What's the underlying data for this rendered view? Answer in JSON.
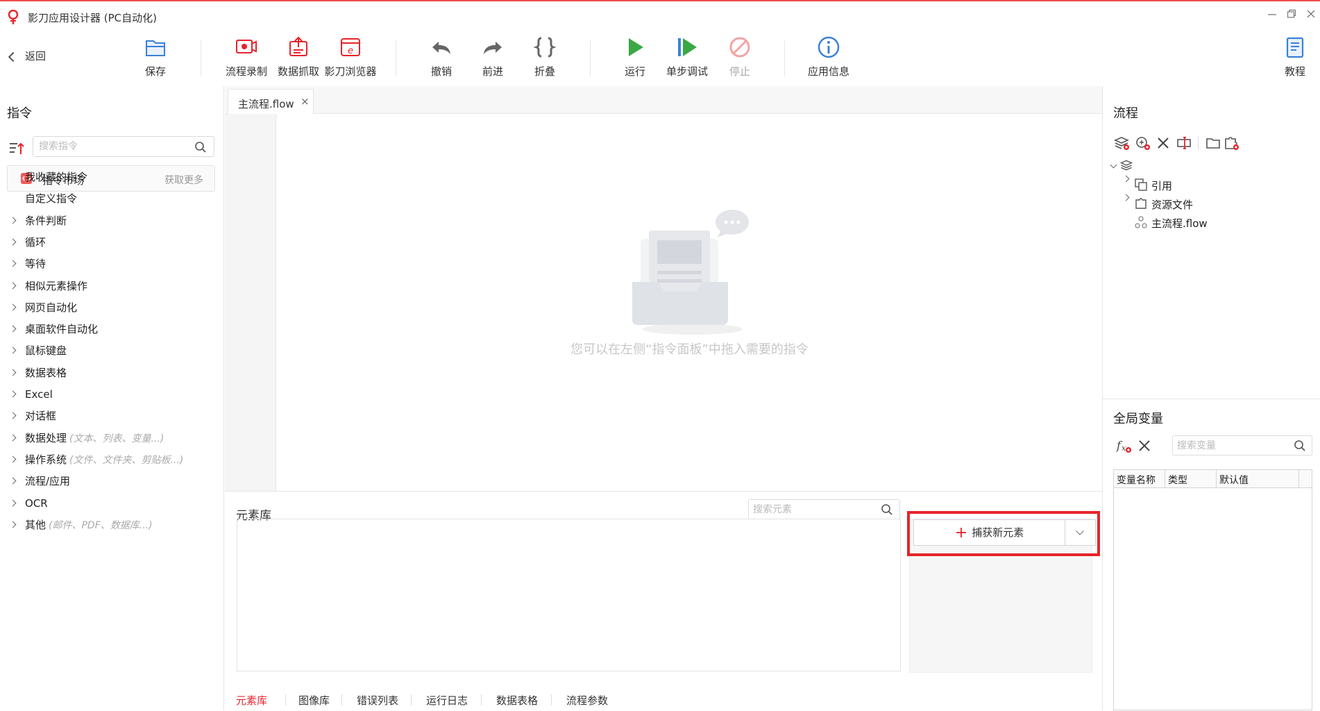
{
  "window": {
    "title": "影刀应用设计器 (PC自动化)"
  },
  "toolbar": {
    "back_label": "返回",
    "items": [
      {
        "label": "保存",
        "icon": "folder-save-icon"
      },
      {
        "label": "流程录制",
        "icon": "record-icon"
      },
      {
        "label": "数据抓取",
        "icon": "data-grab-icon"
      },
      {
        "label": "影刀浏览器",
        "icon": "browser-icon"
      },
      {
        "label": "撤销",
        "icon": "undo-icon"
      },
      {
        "label": "前进",
        "icon": "redo-icon"
      },
      {
        "label": "折叠",
        "icon": "braces-icon"
      },
      {
        "label": "运行",
        "icon": "play-icon"
      },
      {
        "label": "单步调试",
        "icon": "step-debug-icon"
      },
      {
        "label": "停止",
        "icon": "stop-icon"
      },
      {
        "label": "应用信息",
        "icon": "info-icon"
      },
      {
        "label": "教程",
        "icon": "tutorial-icon"
      }
    ]
  },
  "left": {
    "title": "指令",
    "search_placeholder": "搜索指令",
    "market": {
      "label": "指令市场",
      "more": "获取更多"
    },
    "categories": [
      {
        "label": "我收藏的指令",
        "hint": ""
      },
      {
        "label": "自定义指令",
        "hint": ""
      },
      {
        "label": "条件判断",
        "hint": ""
      },
      {
        "label": "循环",
        "hint": ""
      },
      {
        "label": "等待",
        "hint": ""
      },
      {
        "label": "相似元素操作",
        "hint": ""
      },
      {
        "label": "网页自动化",
        "hint": ""
      },
      {
        "label": "桌面软件自动化",
        "hint": ""
      },
      {
        "label": "鼠标键盘",
        "hint": ""
      },
      {
        "label": "数据表格",
        "hint": ""
      },
      {
        "label": "Excel",
        "hint": ""
      },
      {
        "label": "对话框",
        "hint": ""
      },
      {
        "label": "数据处理",
        "hint": "(文本、列表、变量...)"
      },
      {
        "label": "操作系统",
        "hint": "(文件、文件夹、剪贴板...)"
      },
      {
        "label": "流程/应用",
        "hint": ""
      },
      {
        "label": "OCR",
        "hint": ""
      },
      {
        "label": "其他",
        "hint": "(邮件、PDF、数据库...)"
      }
    ]
  },
  "editor": {
    "tab_label": "主流程.flow",
    "tab_close": "×",
    "empty_text": "您可以在左侧“指令面板”中拖入需要的指令"
  },
  "elements": {
    "title": "元素库",
    "search_placeholder": "搜索元素",
    "capture_label": "捕获新元素",
    "capture_plus": "+",
    "bottom_tabs": [
      "元素库",
      "图像库",
      "错误列表",
      "运行日志",
      "数据表格",
      "流程参数"
    ]
  },
  "right": {
    "flow_title": "流程",
    "tree": [
      {
        "label": "引用",
        "icon": "reference-icon"
      },
      {
        "label": "资源文件",
        "icon": "resource-file-icon"
      },
      {
        "label": "主流程.flow",
        "icon": "flow-file-icon"
      }
    ],
    "vars_title": "全局变量",
    "var_search_placeholder": "搜索变量",
    "var_columns": [
      "变量名称",
      "类型",
      "默认值"
    ]
  },
  "colors": {
    "accent": "#e8232a",
    "primary_blue": "#3b82d6",
    "run_green": "#3aa845"
  }
}
